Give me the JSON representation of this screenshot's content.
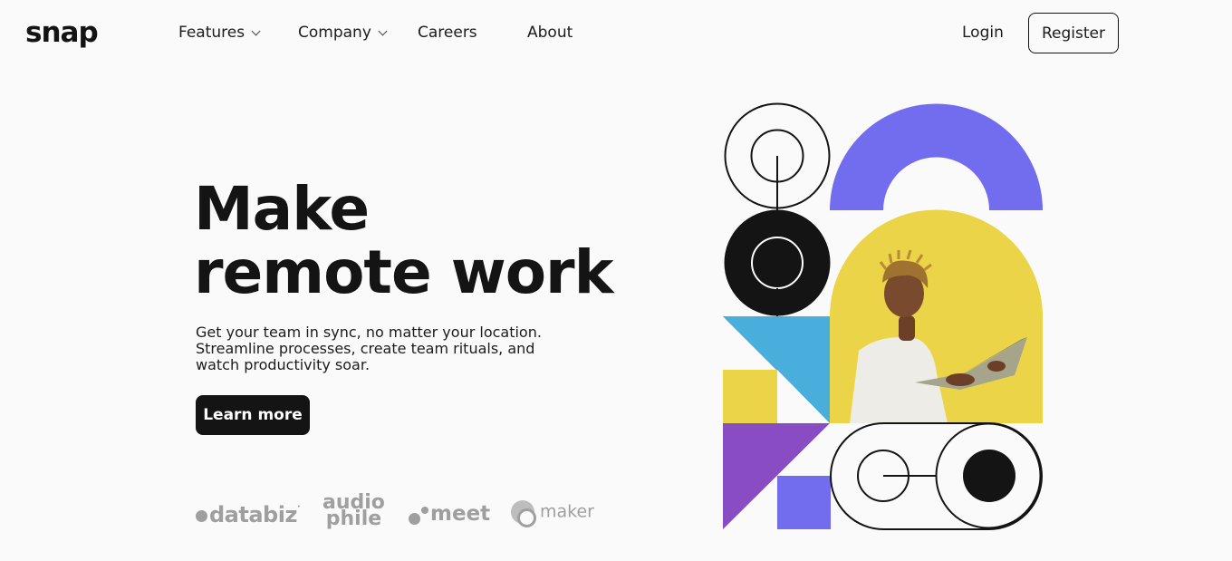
{
  "brand": {
    "logo": "snap"
  },
  "nav": {
    "items": [
      {
        "label": "Features",
        "has_dropdown": true
      },
      {
        "label": "Company",
        "has_dropdown": true
      },
      {
        "label": "Careers",
        "has_dropdown": false
      },
      {
        "label": "About",
        "has_dropdown": false
      }
    ],
    "login_label": "Login",
    "register_label": "Register"
  },
  "hero": {
    "title_line1": "Make",
    "title_line2": "remote work",
    "desc_line1": "Get your team in sync, no matter your location.",
    "desc_line2": "Streamline processes, create team rituals, and",
    "desc_line3": "watch productivity soar.",
    "cta_label": "Learn more"
  },
  "clients": {
    "databiz": "databiz",
    "audiophile_line1": "audio",
    "audiophile_line2": "phile",
    "meet": "meet",
    "maker": "maker"
  },
  "colors": {
    "dark": "#141414",
    "background": "#fafafa",
    "purple": "#726cee",
    "yellow": "#ebd447",
    "blue": "#4aaedc",
    "violet": "#8a4cc2",
    "client_gray": "#9f9f9f"
  }
}
